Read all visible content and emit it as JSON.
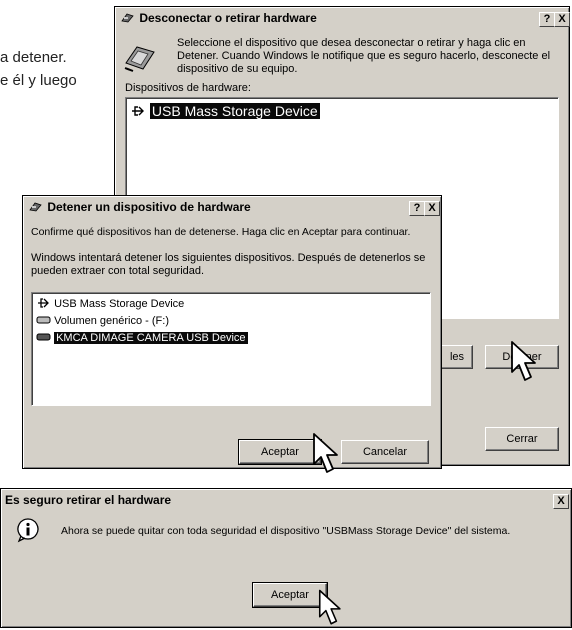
{
  "background_text": {
    "line1": "a detener.",
    "line2": "e él y luego"
  },
  "win_disconnect": {
    "title": "Desconectar o retirar  hardware",
    "help_btn": "?",
    "close_btn": "X",
    "instruction": "Seleccione el dispositivo que desea desconectar o retirar y haga clic en Detener. Cuando Windows le notifique que es seguro hacerlo, desconecte el dispositivo de su equipo.",
    "devices_label": "Dispositivos de hardware:",
    "devices": [
      "USB Mass Storage Device"
    ],
    "properties_btn_fragment": "les",
    "stop_btn": "Detener",
    "close_button": "Cerrar"
  },
  "win_stop": {
    "title": "Detener un dispositivo de hardware",
    "help_btn": "?",
    "close_btn": "X",
    "confirm_text": "Confirme qué dispositivos han de detenerse. Haga clic en Aceptar para continuar.",
    "info_text": "Windows intentará detener los siguientes dispositivos. Después de detenerlos se pueden extraer con total seguridad.",
    "devices": [
      "USB Mass Storage Device",
      "Volumen genérico - (F:)",
      "KMCA DIMAGE CAMERA USB Device"
    ],
    "ok_btn": "Aceptar",
    "cancel_btn": "Cancelar"
  },
  "win_safe": {
    "title": "Es seguro retirar el hardware",
    "close_btn": "X",
    "message": "Ahora se puede quitar con toda seguridad el dispositivo \"USBMass Storage Device\" del sistema.",
    "ok_btn": "Aceptar"
  },
  "icons": [
    "hardware-icon",
    "usb-icon",
    "drive-icon",
    "info-icon",
    "mouse-cursor-icon"
  ]
}
